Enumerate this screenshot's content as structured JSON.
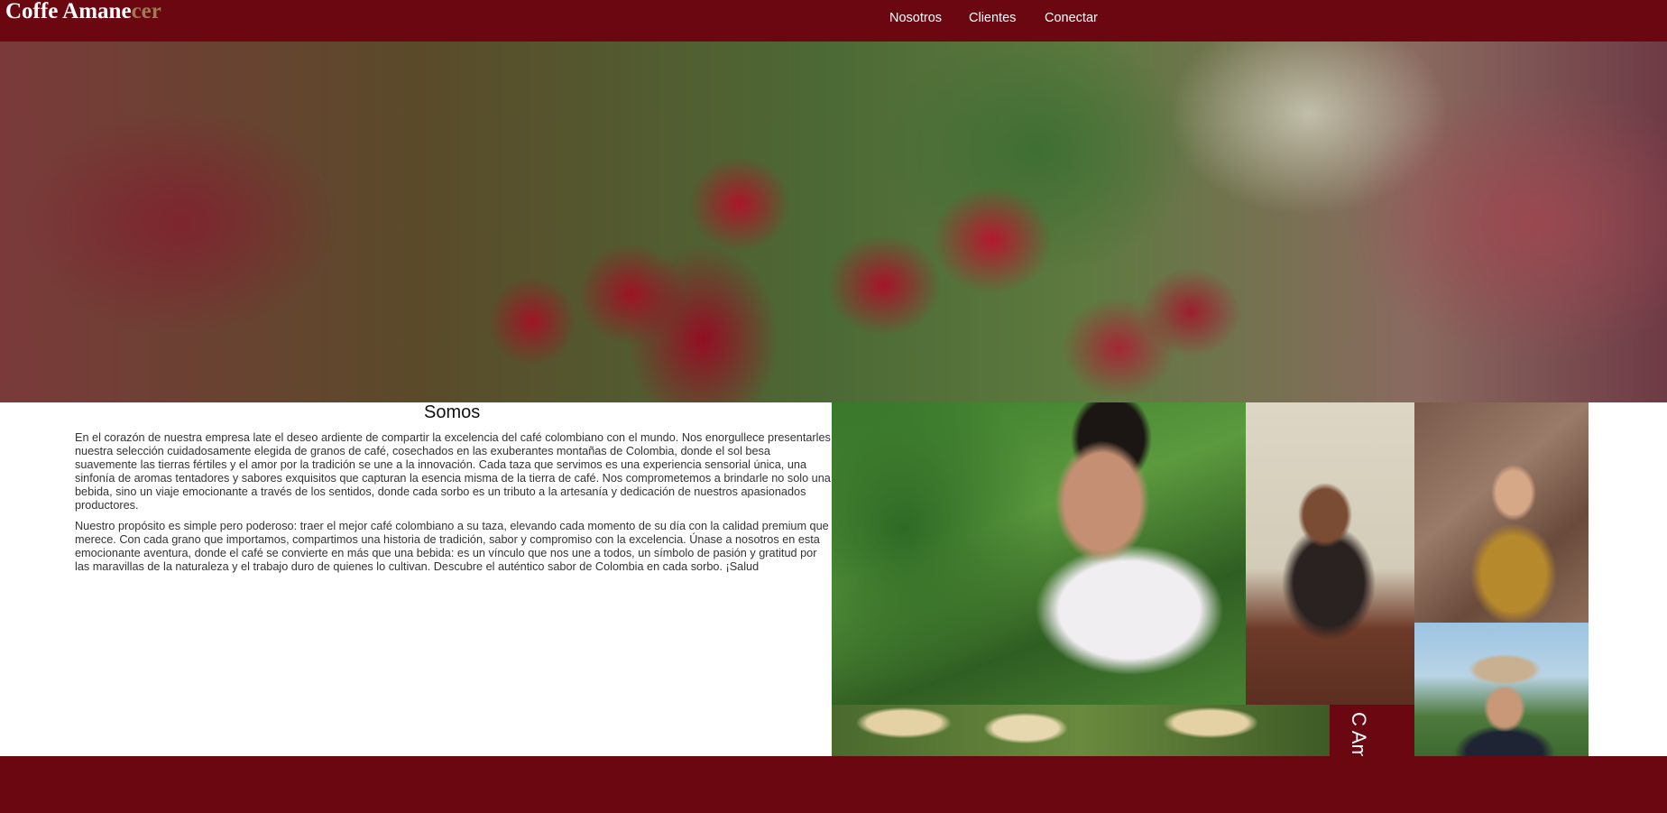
{
  "brand": {
    "name_main": "Coffe Amane",
    "name_accent": "cer"
  },
  "nav": {
    "items": [
      {
        "label": "Nosotros"
      },
      {
        "label": "Clientes"
      },
      {
        "label": "Conectar"
      }
    ]
  },
  "hero": {
    "image": "coffee-cherries-photo"
  },
  "about": {
    "title": "Somos",
    "paragraphs": [
      "En el corazón de nuestra empresa late el deseo ardiente de compartir la excelencia del café colombiano con el mundo. Nos enorgullece presentarles nuestra selección cuidadosamente elegida de granos de café, cosechados en las exuberantes montañas de Colombia, donde el sol besa suavemente las tierras fértiles y el amor por la tradición se une a la innovación. Cada taza que servimos es una experiencia sensorial única, una sinfonía de aromas tentadores y sabores exquisitos que capturan la esencia misma de la tierra de café. Nos comprometemos a brindarle no solo una bebida, sino un viaje emocionante a través de los sentidos, donde cada sorbo es un tributo a la artesanía y dedicación de nuestros apasionados productores.",
      "Nuestro propósito es simple pero poderoso: traer el mejor café colombiano a su taza, elevando cada momento de su día con la calidad premium que merece. Con cada grano que importamos, compartimos una historia de tradición, sabor y compromiso con la excelencia. Únase a nosotros en esta emocionante aventura, donde el café se convierte en más que una bebida: es un vínculo que nos une a todos, un símbolo de pasión y gratitud por las maravillas de la naturaleza y el trabajo duro de quienes lo cultivan. Descubre el auténtico sabor de Colombia en cada sorbo. ¡Salud"
    ]
  },
  "gallery": {
    "photos": [
      {
        "name": "coffee-farmer-photo"
      },
      {
        "name": "girl-drinking-coffee-photo"
      },
      {
        "name": "smiling-woman-photo"
      },
      {
        "name": "man-with-hat-photo"
      },
      {
        "name": "farmers-group-photo"
      }
    ],
    "panel_text": "C Am"
  },
  "colors": {
    "primary": "#6b0710",
    "accent": "#a07a52",
    "text": "#333333"
  }
}
